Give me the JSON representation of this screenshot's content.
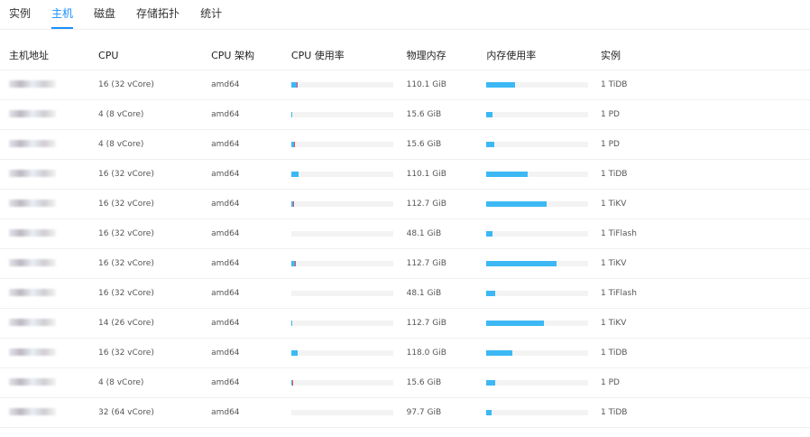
{
  "tabs": [
    "实例",
    "主机",
    "磁盘",
    "存储拓扑",
    "统计"
  ],
  "active_tab": 1,
  "columns": [
    "主机地址",
    "CPU",
    "CPU 架构",
    "CPU 使用率",
    "物理内存",
    "内存使用率",
    "实例"
  ],
  "colors": {
    "accent": "#1890ff",
    "bar": "#3cb8f4",
    "bar_alert": "#f5455b",
    "track": "#f3f3f3"
  },
  "rows": [
    {
      "cpu": "16 (32 vCore)",
      "arch": "amd64",
      "cpu_pct": 5,
      "cpu_alert": true,
      "mem": "110.1 GiB",
      "mem_pct": 28,
      "inst": "1 TiDB"
    },
    {
      "cpu": "4 (8 vCore)",
      "arch": "amd64",
      "cpu_pct": 1,
      "cpu_alert": false,
      "mem": "15.6 GiB",
      "mem_pct": 6,
      "inst": "1 PD"
    },
    {
      "cpu": "4 (8 vCore)",
      "arch": "amd64",
      "cpu_pct": 3,
      "cpu_alert": true,
      "mem": "15.6 GiB",
      "mem_pct": 8,
      "inst": "1 PD"
    },
    {
      "cpu": "16 (32 vCore)",
      "arch": "amd64",
      "cpu_pct": 7,
      "cpu_alert": false,
      "mem": "110.1 GiB",
      "mem_pct": 40,
      "inst": "1 TiDB"
    },
    {
      "cpu": "16 (32 vCore)",
      "arch": "amd64",
      "cpu_pct": 2,
      "cpu_alert": true,
      "mem": "112.7 GiB",
      "mem_pct": 59,
      "inst": "1 TiKV"
    },
    {
      "cpu": "16 (32 vCore)",
      "arch": "amd64",
      "cpu_pct": 0,
      "cpu_alert": false,
      "mem": "48.1 GiB",
      "mem_pct": 6,
      "inst": "1 TiFlash"
    },
    {
      "cpu": "16 (32 vCore)",
      "arch": "amd64",
      "cpu_pct": 4,
      "cpu_alert": true,
      "mem": "112.7 GiB",
      "mem_pct": 69,
      "inst": "1 TiKV"
    },
    {
      "cpu": "16 (32 vCore)",
      "arch": "amd64",
      "cpu_pct": 0,
      "cpu_alert": false,
      "mem": "48.1 GiB",
      "mem_pct": 9,
      "inst": "1 TiFlash"
    },
    {
      "cpu": "14 (26 vCore)",
      "arch": "amd64",
      "cpu_pct": 1,
      "cpu_alert": false,
      "mem": "112.7 GiB",
      "mem_pct": 56,
      "inst": "1 TiKV"
    },
    {
      "cpu": "16 (32 vCore)",
      "arch": "amd64",
      "cpu_pct": 6,
      "cpu_alert": false,
      "mem": "118.0 GiB",
      "mem_pct": 25,
      "inst": "1 TiDB"
    },
    {
      "cpu": "4 (8 vCore)",
      "arch": "amd64",
      "cpu_pct": 1,
      "cpu_alert": true,
      "mem": "15.6 GiB",
      "mem_pct": 9,
      "inst": "1 PD"
    },
    {
      "cpu": "32 (64 vCore)",
      "arch": "amd64",
      "cpu_pct": 0,
      "cpu_alert": false,
      "mem": "97.7 GiB",
      "mem_pct": 5,
      "inst": "1 TiDB"
    }
  ]
}
